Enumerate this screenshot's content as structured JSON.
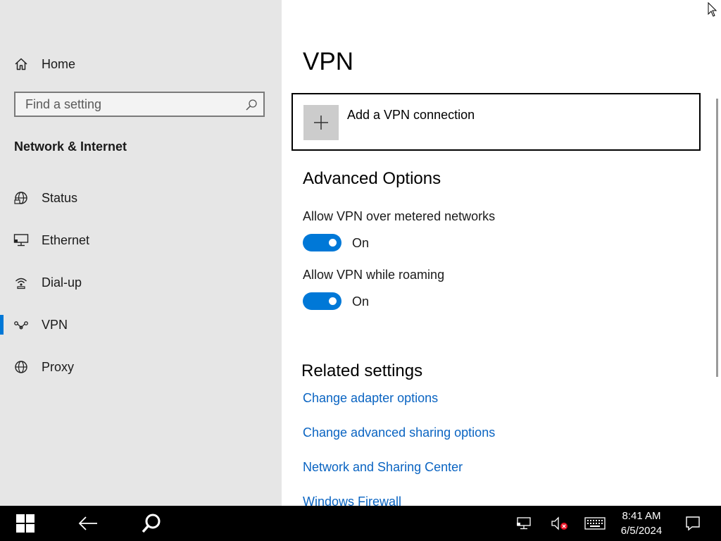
{
  "sidebar": {
    "home_label": "Home",
    "search_placeholder": "Find a setting",
    "section_title": "Network & Internet",
    "items": [
      {
        "label": "Status",
        "icon": "globe-status-icon"
      },
      {
        "label": "Ethernet",
        "icon": "ethernet-icon"
      },
      {
        "label": "Dial-up",
        "icon": "dial-up-icon"
      },
      {
        "label": "VPN",
        "icon": "vpn-icon",
        "selected": true
      },
      {
        "label": "Proxy",
        "icon": "globe-icon"
      }
    ]
  },
  "main": {
    "title": "VPN",
    "add_vpn_label": "Add a VPN connection",
    "advanced_heading": "Advanced Options",
    "options": [
      {
        "label": "Allow VPN over metered networks",
        "state": "On"
      },
      {
        "label": "Allow VPN while roaming",
        "state": "On"
      }
    ],
    "related_heading": "Related settings",
    "links": [
      "Change adapter options",
      "Change advanced sharing options",
      "Network and Sharing Center",
      "Windows Firewall"
    ]
  },
  "taskbar": {
    "time": "8:41 AM",
    "date": "6/5/2024"
  },
  "colors": {
    "accent": "#0078d7",
    "link": "#0a64c2",
    "sidebar_bg": "#e6e6e6",
    "taskbar_bg": "#000000"
  }
}
